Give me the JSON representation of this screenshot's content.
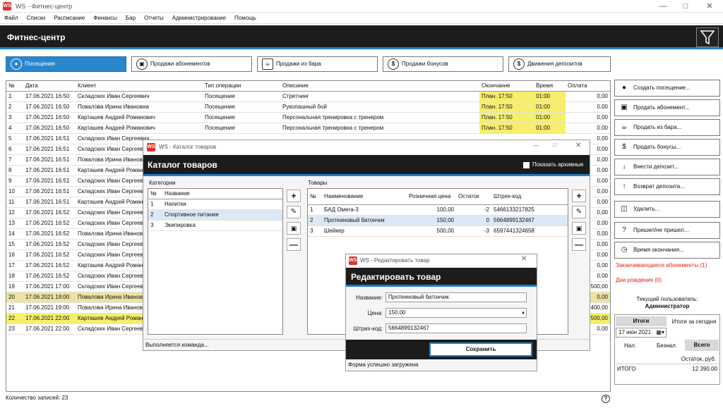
{
  "window": {
    "title": "WS - Фитнес-центр",
    "icon_text": "WS"
  },
  "menu": [
    "Файл",
    "Списки",
    "Расписание",
    "Финансы",
    "Бар",
    "Отчеты",
    "Администрирование",
    "Помощь"
  ],
  "header": {
    "title": "Фитнес-центр"
  },
  "tabs": [
    {
      "label": "Посещения"
    },
    {
      "label": "Продажи абонементов"
    },
    {
      "label": "Продажи из бара"
    },
    {
      "label": "Продажи бонусов"
    },
    {
      "label": "Движения депозитов"
    }
  ],
  "grid": {
    "columns": [
      "№",
      "Дата",
      "Клиент",
      "Тип операции",
      "Описание",
      "Окончание",
      "Время",
      "Оплата"
    ],
    "rows": [
      [
        "1",
        "17.06.2021 16:50",
        "Складских Иван Сергеевич",
        "Посещение",
        "Стретчинг",
        "План. 17:50",
        "01:00",
        "0,00"
      ],
      [
        "2",
        "17.06.2021 16:50",
        "Повалова Ирина Ивановна",
        "Посещение",
        "Рукопашный бой",
        "План. 17:50",
        "01:00",
        "0,00"
      ],
      [
        "3",
        "17.06.2021 16:50",
        "Карташев Андрей Романович",
        "Посещение",
        "Персональная тренировка с тренером",
        "План. 17:50",
        "01:00",
        "0,00"
      ],
      [
        "4",
        "17.06.2021 16:50",
        "Карташев Андрей Романович",
        "Посещение",
        "Персональная тренировка с тренером",
        "План. 17:50",
        "01:00",
        "0,00"
      ],
      [
        "5",
        "17.06.2021 16:51",
        "Складских Иван Сергеевич",
        "",
        "",
        "",
        "",
        "0,00"
      ],
      [
        "6",
        "17.06.2021 16:51",
        "Складских Иван Сергеевич",
        "",
        "",
        "",
        "",
        "0,00"
      ],
      [
        "7",
        "17.06.2021 16:51",
        "Повалова Ирина Ивановна",
        "",
        "",
        "",
        "",
        "0,00"
      ],
      [
        "8",
        "17.06.2021 16:51",
        "Карташев Андрей Романович",
        "",
        "",
        "",
        "",
        "0,00"
      ],
      [
        "9",
        "17.06.2021 16:51",
        "Складских Иван Сергеевич",
        "",
        "",
        "",
        "",
        "0,00"
      ],
      [
        "10",
        "17.06.2021 16:51",
        "Складских Иван Сергеевич",
        "",
        "",
        "",
        "",
        "0,00"
      ],
      [
        "11",
        "17.06.2021 16:51",
        "Карташев Андрей Романович",
        "",
        "",
        "",
        "",
        "0,00"
      ],
      [
        "12",
        "17.06.2021 16:52",
        "Складских Иван Сергеевич",
        "",
        "",
        "",
        "",
        "0,00"
      ],
      [
        "13",
        "17.06.2021 16:52",
        "Складских Иван Сергеевич",
        "",
        "",
        "",
        "",
        "0,00"
      ],
      [
        "14",
        "17.06.2021 16:52",
        "Повалова Ирина Ивановна",
        "",
        "",
        "",
        "",
        "0,00"
      ],
      [
        "15",
        "17.06.2021 16:52",
        "Складских Иван Сергеевич",
        "",
        "",
        "",
        "",
        "0,00"
      ],
      [
        "16",
        "17.06.2021 16:52",
        "Складских Иван Сергеевич",
        "",
        "",
        "",
        "",
        "0,00"
      ],
      [
        "17",
        "17.06.2021 16:52",
        "Карташев Андрей Романович",
        "",
        "",
        "",
        "",
        "0,00"
      ],
      [
        "18",
        "17.06.2021 16:52",
        "Складских Иван Сергеевич",
        "",
        "",
        "",
        "",
        "0,00"
      ],
      [
        "19",
        "17.06.2021 17:00",
        "Складских Иван Сергеевич",
        "",
        "",
        "",
        "",
        "500,00"
      ],
      [
        "20",
        "17.06.2021 19:00",
        "Повалова Ирина Ивановна",
        "",
        "",
        "",
        "",
        "0,00"
      ],
      [
        "21",
        "17.06.2021 19:00",
        "Повалова Ирина Ивановна",
        "",
        "",
        "",
        "",
        "400,00"
      ],
      [
        "22",
        "17.06.2021 22:00",
        "Карташев Андрей Романович",
        "",
        "",
        "",
        "",
        "500,00"
      ],
      [
        "23",
        "17.06.2021 22:00",
        "Складских Иван Сергеевич",
        "",
        "",
        "",
        "",
        "0,00"
      ]
    ],
    "highlight_rows": [
      19
    ],
    "yellow_rows": [
      21
    ]
  },
  "status": {
    "records": "Количество записей: 23"
  },
  "sidebar": {
    "buttons": [
      {
        "label": "Создать посещение...",
        "icon": "person-icon"
      },
      {
        "label": "Продать абонемент...",
        "icon": "card-icon"
      },
      {
        "label": "Продать из бара...",
        "icon": "cup-icon"
      },
      {
        "label": "Продать бонусы...",
        "icon": "dollar-icon"
      },
      {
        "label": "Внести депозит...",
        "icon": "deposit-in-icon"
      },
      {
        "label": "Возврат депозита...",
        "icon": "deposit-out-icon"
      },
      {
        "label": "Удалить...",
        "icon": "trash-icon"
      },
      {
        "label": "Пришел/не пришел...",
        "icon": "question-icon"
      },
      {
        "label": "Время окончания...",
        "icon": "clock-icon"
      }
    ],
    "links": [
      "Заканчивающиеся абонементы (1)",
      "Дни рождения (0)"
    ],
    "current_user_label": "Текущий пользователь:",
    "current_user": "Администратор",
    "totals_label": "Итоги",
    "totals_today": "Итоги за сегодня",
    "date": "17 июн 2021",
    "tabs": [
      "Нал.",
      "Безнал.",
      "Всего"
    ],
    "col": "Остаток, руб.",
    "total_label": "ИТОГО",
    "total_value": "12 390,00"
  },
  "catalog": {
    "window_title": "WS - Каталог товаров",
    "title": "Каталог товаров",
    "show_archive": "Показать архивные",
    "categories_label": "Категории",
    "categories_columns": [
      "№",
      "Название"
    ],
    "categories": [
      [
        "1",
        "Напитки"
      ],
      [
        "2",
        "Спортивное питание"
      ],
      [
        "3",
        "Экипировка"
      ]
    ],
    "goods_label": "Товары",
    "goods_columns": [
      "№",
      "Наименование",
      "Розничная цена",
      "Остаток",
      "Штрих-код"
    ],
    "goods": [
      [
        "1",
        "БАД Омега-3",
        "100,00",
        "-2",
        "5466133217825"
      ],
      [
        "2",
        "Протеиновый батончик",
        "150,00",
        "0",
        "5664899132467"
      ],
      [
        "3",
        "Шейкер",
        "500,00",
        "-3",
        "6597441324658"
      ]
    ],
    "status": "Выполняется команда..."
  },
  "edit": {
    "window_title": "WS - Редактировать товар",
    "title": "Редактировать товар",
    "name_label": "Название:",
    "name": "Протеиновый батончик",
    "price_label": "Цена:",
    "price": "150,00",
    "barcode_label": "Штрих-код:",
    "barcode": "5664899132467",
    "save": "Сохранить",
    "status": "Форма успешно загружена"
  },
  "colors": {
    "accent": "#1f7ec7",
    "dark": "#1c1c1c",
    "yellow": "#f6ee6c",
    "red": "#d8251d"
  }
}
